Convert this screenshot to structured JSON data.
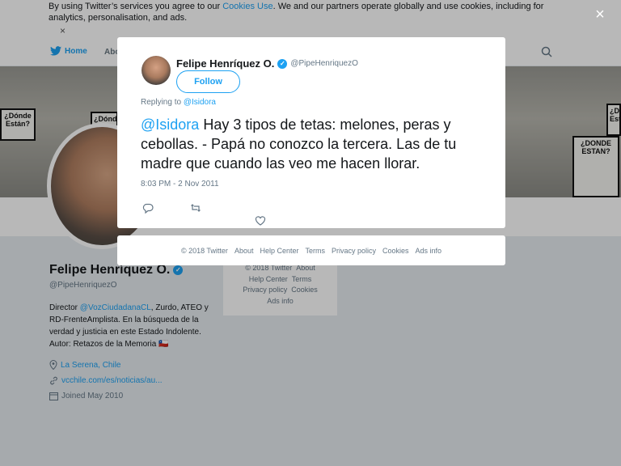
{
  "cookie_bar": {
    "text_before": "By using Twitter’s services you agree to our ",
    "link": "Cookies Use",
    "text_after": ". We and our partners operate globally and use cookies, including for analytics, personalisation, and ads.",
    "close": "×"
  },
  "nav": {
    "home": "Home",
    "about": "Abo"
  },
  "banner_signs": [
    "¿Dónde Están?",
    "¿DONDE ESTAN?",
    "¿Dónde",
    "¿Dónde Están?"
  ],
  "profile": {
    "name": "Felipe Henríquez O.",
    "handle": "@PipeHenriquezO",
    "bio_pre": "Director ",
    "bio_link": "@VozCiudadanaCL",
    "bio_post": ", Zurdo, ATEO y RD-FrenteAmplista. En la búsqueda de la verdad y justicia en este Estado Indolente. Autor: Retazos de la Memoria 🇨🇱",
    "location": "La Serena, Chile",
    "website": "vcchile.com/es/noticias/au...",
    "joined": "Joined May 2010"
  },
  "side_footer": [
    "© 2018 Twitter",
    "About",
    "Help Center",
    "Terms",
    "Privacy policy",
    "Cookies",
    "Ads info"
  ],
  "overlay": {
    "close": "×"
  },
  "tweet": {
    "author_name": "Felipe Henríquez O.",
    "author_handle": "@PipeHenriquezO",
    "follow_label": "Follow",
    "replying_prefix": "Replying to ",
    "replying_to": "@Isidora",
    "mention": "@Isidora",
    "body": " Hay 3 tipos de tetas: melones, peras y cebollas. - Papá no conozco la tercera. Las de tu madre que cuando las veo me hacen llorar.",
    "timestamp": "8:03 PM - 2 Nov 2011"
  },
  "modal_footer": [
    "© 2018 Twitter",
    "About",
    "Help Center",
    "Terms",
    "Privacy policy",
    "Cookies",
    "Ads info"
  ],
  "colors": {
    "accent": "#1da1f2",
    "muted": "#657786",
    "text": "#14171a"
  },
  "icons": [
    "twitter-bird-icon",
    "search-icon",
    "verified-icon",
    "reply-icon",
    "retweet-icon",
    "like-icon",
    "location-icon",
    "link-icon",
    "calendar-icon",
    "close-icon"
  ]
}
